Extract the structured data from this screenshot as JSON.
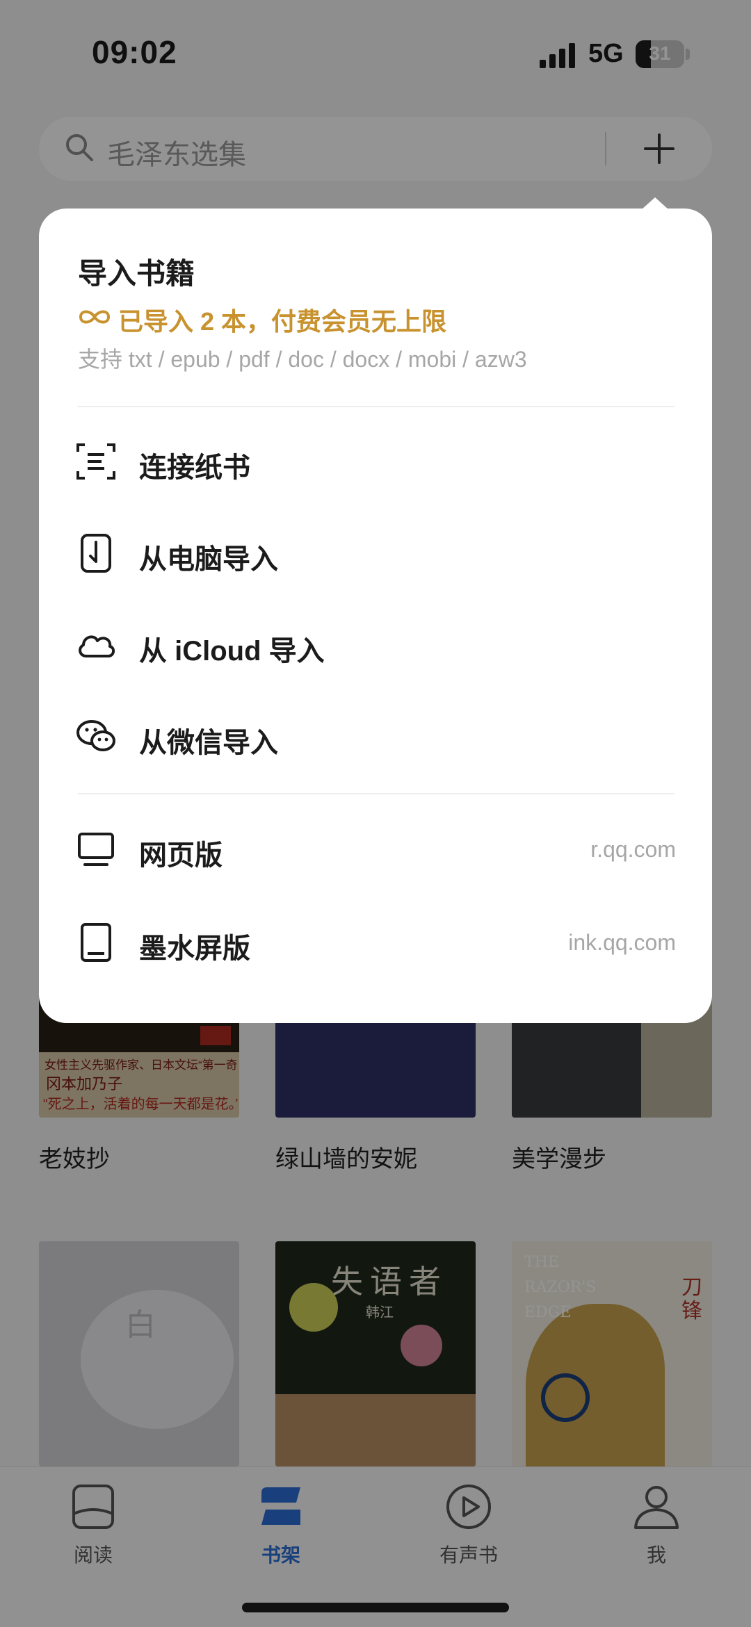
{
  "status": {
    "time": "09:02",
    "network": "5G",
    "battery": "31",
    "battery_level": 0.31
  },
  "search": {
    "placeholder": "毛泽东选集"
  },
  "books": [
    {
      "title": "老妓抄"
    },
    {
      "title": "绿山墙的安妮"
    },
    {
      "title": "美学漫步"
    }
  ],
  "covers": {
    "laojichao": {
      "line1": "女性主义先驱作家、日本文坛“第一奇女子”",
      "author": "冈本加乃子",
      "quote": "“死之上，活着的每一天都是花。”"
    },
    "bai": {
      "title": "白"
    },
    "shiyuzhe": {
      "title": "失语者",
      "author": "韩江"
    },
    "razor": {
      "title_en_1": "THE",
      "title_en_2": "RAZOR'S",
      "title_en_3": "EDGE",
      "title_cn": "刀锋"
    }
  },
  "tabs": [
    {
      "label": "阅读",
      "icon": "book-icon"
    },
    {
      "label": "书架",
      "icon": "bookshelf-icon",
      "active": true
    },
    {
      "label": "有声书",
      "icon": "play-icon"
    },
    {
      "label": "我",
      "icon": "person-icon"
    }
  ],
  "popup": {
    "title": "导入书籍",
    "quota": "已导入 2 本，付费会员无上限",
    "formats": "支持 txt / epub / pdf / doc / docx / mobi / azw3",
    "items": [
      {
        "label": "连接纸书",
        "icon": "scan-icon"
      },
      {
        "label": "从电脑导入",
        "icon": "phone-import-icon"
      },
      {
        "label": "从 iCloud 导入",
        "icon": "cloud-icon"
      },
      {
        "label": "从微信导入",
        "icon": "wechat-icon"
      },
      {
        "label": "网页版",
        "icon": "monitor-icon",
        "url": "r.qq.com"
      },
      {
        "label": "墨水屏版",
        "icon": "tablet-icon",
        "url": "ink.qq.com"
      }
    ]
  },
  "colors": {
    "accent_gold": "#c8922e",
    "tab_active": "#2b6fd6"
  }
}
